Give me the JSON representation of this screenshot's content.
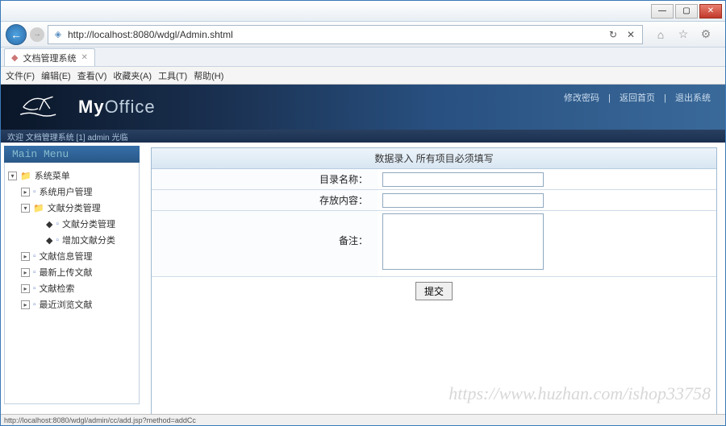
{
  "window": {
    "min": "—",
    "max": "▢",
    "close": "✕"
  },
  "address": {
    "url": "http://localhost:8080/wdgl/Admin.shtml",
    "host": "localhost"
  },
  "tab": {
    "title": "文档管理系统"
  },
  "menu": {
    "file": "文件(F)",
    "edit": "编辑(E)",
    "view": "查看(V)",
    "fav": "收藏夹(A)",
    "tools": "工具(T)",
    "help": "帮助(H)"
  },
  "banner": {
    "brand_pre": "My",
    "brand_post": "Office",
    "links": {
      "a": "修改密码",
      "b": "返回首页",
      "c": "退出系统",
      "sep": "|"
    }
  },
  "welcome": "欢迎 文档管理系统 [1] admin 光临",
  "sidebar": {
    "header": "Main Menu",
    "root": "系统菜单",
    "items": [
      {
        "label": "系统用户管理",
        "type": "file"
      },
      {
        "label": "文献分类管理",
        "type": "folder",
        "children": [
          {
            "label": "文献分类管理"
          },
          {
            "label": "增加文献分类"
          }
        ]
      },
      {
        "label": "文献信息管理",
        "type": "file"
      },
      {
        "label": "最新上传文献",
        "type": "file"
      },
      {
        "label": "文献检索",
        "type": "file"
      },
      {
        "label": "最近浏览文献",
        "type": "file"
      }
    ]
  },
  "form": {
    "title": "数据录入 所有项目必须填写",
    "field1": "目录名称：",
    "field2": "存放内容：",
    "field3": "备注：",
    "submit": "提交"
  },
  "status": "http://localhost:8080/wdgl/admin/cc/add.jsp?method=addCc",
  "watermark": "https://www.huzhan.com/ishop33758"
}
